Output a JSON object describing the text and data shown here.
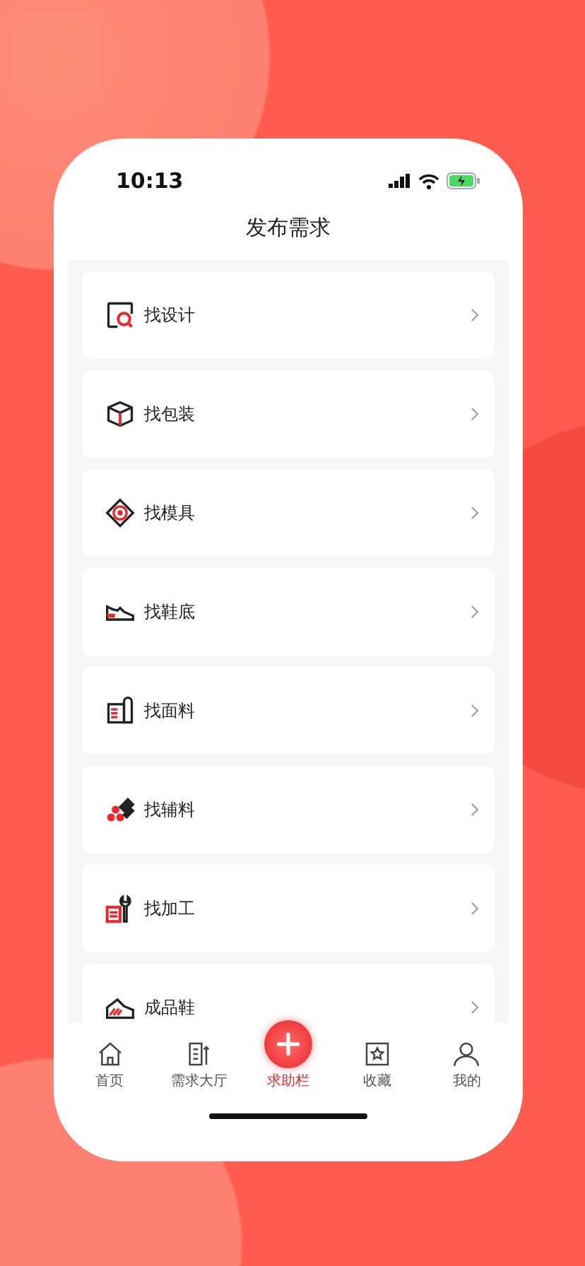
{
  "status_bar": {
    "time": "10:13"
  },
  "header": {
    "title": "发布需求"
  },
  "items": [
    {
      "kind": "design",
      "label": "找设计"
    },
    {
      "kind": "package",
      "label": "找包装"
    },
    {
      "kind": "mold",
      "label": "找模具"
    },
    {
      "kind": "sole",
      "label": "找鞋底"
    },
    {
      "kind": "fabric",
      "label": "找面料"
    },
    {
      "kind": "accessory",
      "label": "找辅料"
    },
    {
      "kind": "process",
      "label": "找加工"
    },
    {
      "kind": "shoe",
      "label": "成品鞋"
    }
  ],
  "tab_bar": [
    {
      "kind": "home",
      "label": "首页",
      "selected": false
    },
    {
      "kind": "demand",
      "label": "需求大厅",
      "selected": false
    },
    {
      "kind": "plus",
      "label": "求助栏",
      "selected": true
    },
    {
      "kind": "favorite",
      "label": "收藏",
      "selected": false
    },
    {
      "kind": "profile",
      "label": "我的",
      "selected": false
    }
  ]
}
